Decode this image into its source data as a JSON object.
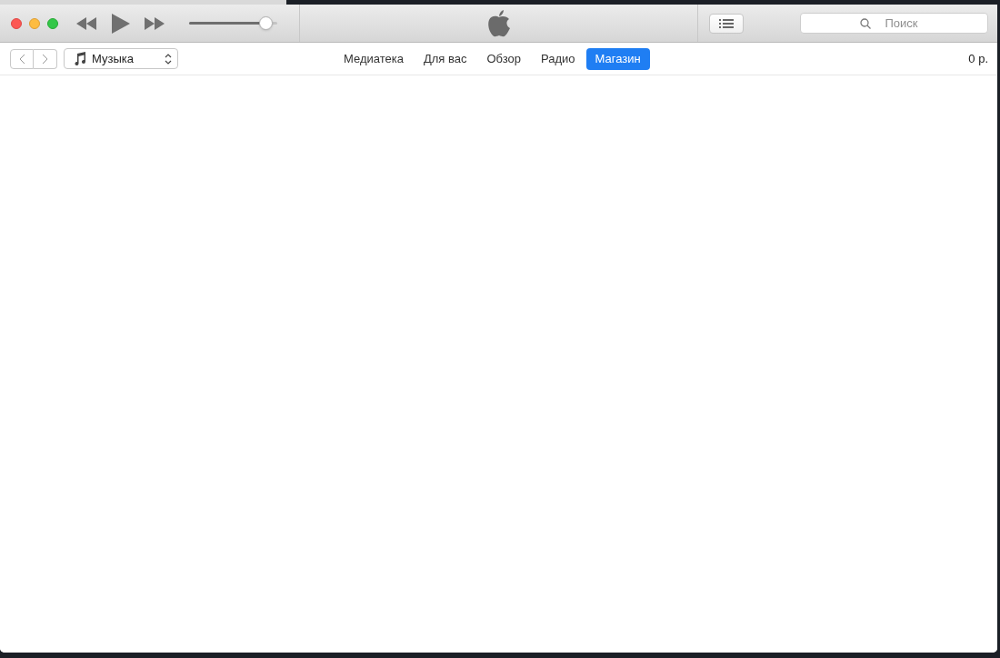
{
  "player": {
    "volume": {
      "level": 0.88
    }
  },
  "toolbar": {
    "search": {
      "placeholder": "Поиск"
    }
  },
  "navigation": {
    "media_picker": "Музыка",
    "tabs": [
      {
        "label": "Медиатека",
        "selected": false
      },
      {
        "label": "Для вас",
        "selected": false
      },
      {
        "label": "Обзор",
        "selected": false
      },
      {
        "label": "Радио",
        "selected": false
      },
      {
        "label": "Магазин",
        "selected": true
      }
    ],
    "balance": "0 р."
  }
}
